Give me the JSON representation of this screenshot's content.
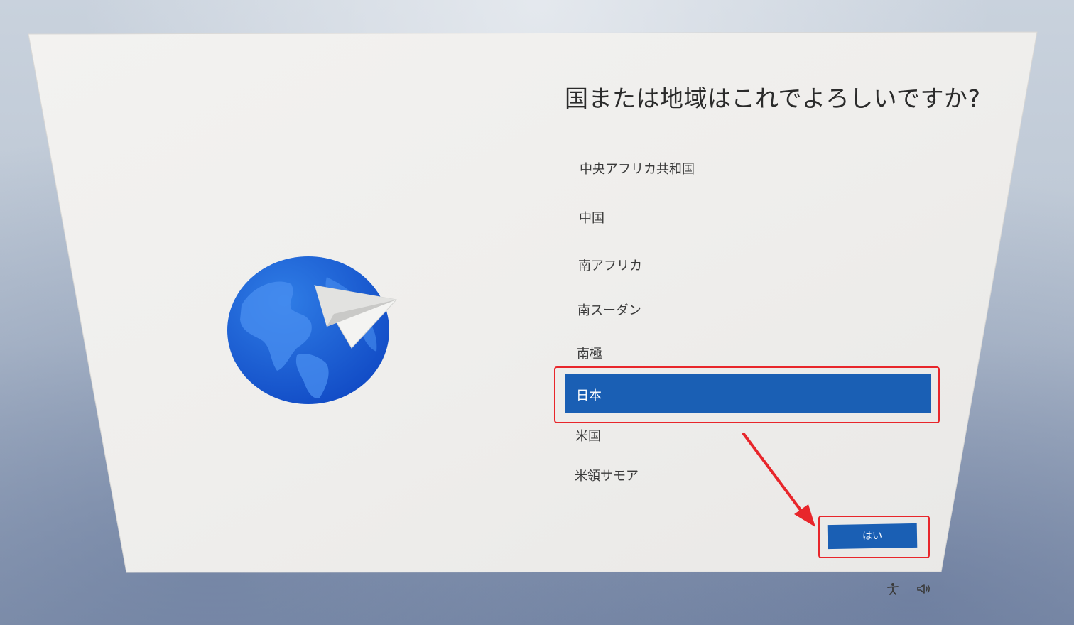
{
  "setup": {
    "heading": "国または地域はこれでよろしいですか?",
    "countries": [
      "中央アフリカ共和国",
      "中国",
      "南アフリカ",
      "南スーダン",
      "南極",
      "日本",
      "米国",
      "米領サモア"
    ],
    "selected_country": "日本",
    "yes_button": "はい"
  },
  "tray": {
    "icons": [
      "accessibility-icon",
      "volume-icon"
    ]
  },
  "colors": {
    "accent": "#1a5fb4",
    "annotation_red": "#e8262b",
    "panel": "#f0efed"
  }
}
